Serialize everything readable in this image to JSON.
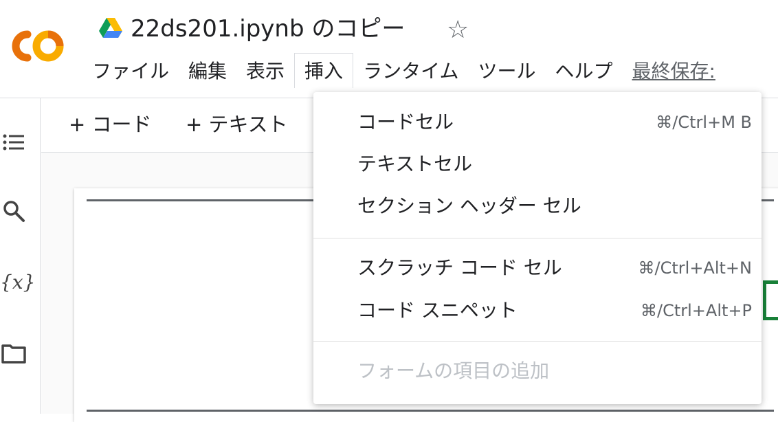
{
  "header": {
    "title": "22ds201.ipynb のコピー",
    "star_glyph": "☆",
    "logo_icon": "colab-logo",
    "drive_icon": "google-drive-icon"
  },
  "menubar": {
    "items": [
      {
        "label": "ファイル"
      },
      {
        "label": "編集"
      },
      {
        "label": "表示"
      },
      {
        "label": "挿入",
        "active": true
      },
      {
        "label": "ランタイム"
      },
      {
        "label": "ツール"
      },
      {
        "label": "ヘルプ"
      }
    ],
    "saved_text": "最終保存:"
  },
  "toolbar": {
    "add_code": "+ コード",
    "add_text": "+ テキスト"
  },
  "left_rail": {
    "icons": [
      "table-of-contents-icon",
      "search-icon",
      "variables-icon",
      "files-icon"
    ],
    "variables_glyph": "{x}"
  },
  "insert_menu": {
    "sections": [
      [
        {
          "label": "コードセル",
          "shortcut": "⌘/Ctrl+M B",
          "enabled": true
        },
        {
          "label": "テキストセル",
          "shortcut": "",
          "enabled": true
        },
        {
          "label": "セクション ヘッダー セル",
          "shortcut": "",
          "enabled": true
        }
      ],
      [
        {
          "label": "スクラッチ コード セル",
          "shortcut": "⌘/Ctrl+Alt+N",
          "enabled": true
        },
        {
          "label": "コード スニペット",
          "shortcut": "⌘/Ctrl+Alt+P",
          "enabled": true
        }
      ],
      [
        {
          "label": "フォームの項目の追加",
          "shortcut": "",
          "enabled": false
        }
      ]
    ]
  },
  "colors": {
    "logo_orange": "#F9AB00",
    "logo_dark_orange": "#E8710A",
    "cell_focus_green": "#188038"
  }
}
